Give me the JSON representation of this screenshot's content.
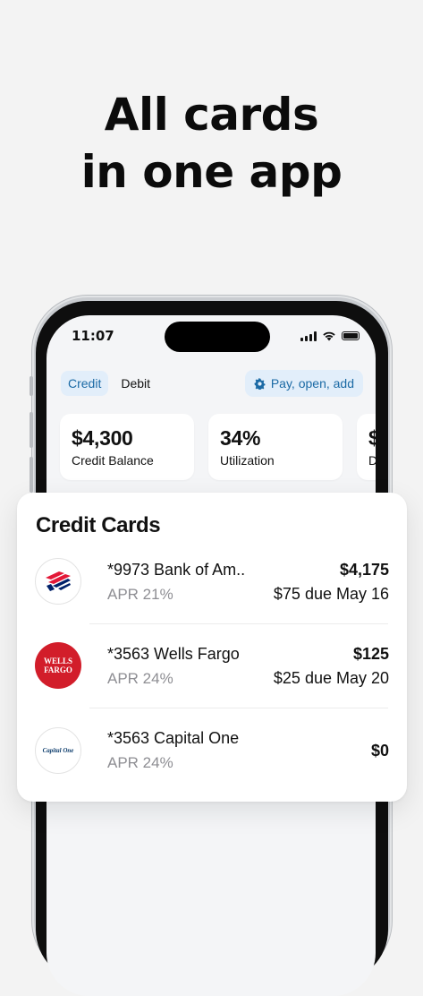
{
  "headline": {
    "line1": "All cards",
    "line2": "in one app"
  },
  "status_bar": {
    "time": "11:07"
  },
  "tabs": [
    {
      "label": "Credit",
      "active": true
    },
    {
      "label": "Debit",
      "active": false
    }
  ],
  "action_button": {
    "label": "Pay, open, add",
    "icon": "gear-icon"
  },
  "stats": [
    {
      "value": "$4,300",
      "label": "Credit Balance"
    },
    {
      "value": "34%",
      "label": "Utilization"
    },
    {
      "value": "$",
      "label": "Du"
    }
  ],
  "credit_cards": {
    "title": "Credit Cards",
    "items": [
      {
        "name": "*9973 Bank of Am..",
        "apr": "APR 21%",
        "balance": "$4,175",
        "due": "$75 due May 16",
        "logo": "bank-of-america-logo"
      },
      {
        "name": "*3563 Wells Fargo",
        "apr": "APR 24%",
        "balance": "$125",
        "due": "$25 due May 20",
        "logo": "wells-fargo-logo",
        "logo_text": "WELLS FARGO"
      },
      {
        "name": "*3563 Capital One",
        "apr": "APR 24%",
        "balance": "$0",
        "due": "",
        "logo": "capital-one-logo",
        "logo_text": "Capital One"
      }
    ]
  },
  "colors": {
    "accent": "#1b6aa5",
    "accent_bg": "#e2eefa",
    "wells_fargo_red": "#d21d2a",
    "boa_red": "#e31837",
    "boa_blue": "#012169"
  }
}
